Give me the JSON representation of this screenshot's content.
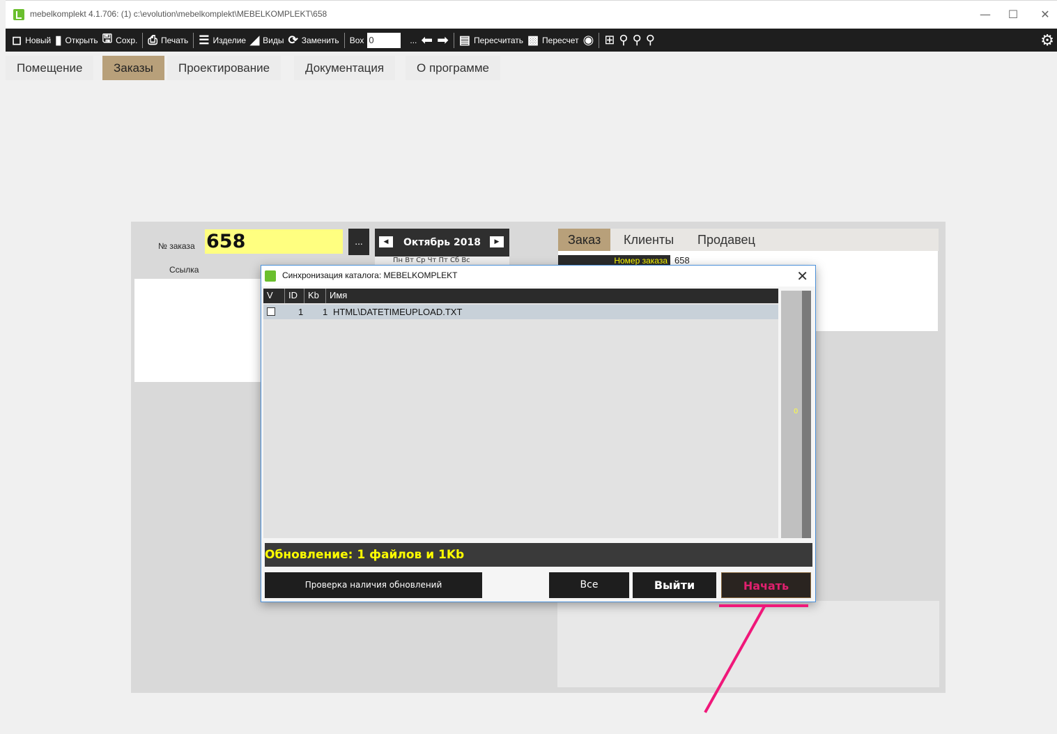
{
  "window": {
    "title": "mebelkomplekt 4.1.706: (1)  c:\\evolution\\mebelkomplekt\\MEBELKOMPLEKT\\658"
  },
  "toolbar": {
    "new": "Новый",
    "open": "Открыть",
    "save": "Сохр.",
    "print": "Печать",
    "product": "Изделие",
    "views": "Виды",
    "replace": "Заменить",
    "box_label": "Box",
    "box_value": "0",
    "ellipsis": "...",
    "recalculate": "Пересчитать",
    "recount": "Пересчет"
  },
  "main_tabs": [
    {
      "label": "Помещение",
      "active": false
    },
    {
      "label": "Заказы",
      "active": true
    },
    {
      "label": "Проектирование",
      "active": false
    },
    {
      "label": "Документация",
      "active": false
    },
    {
      "label": "О программе",
      "active": false
    }
  ],
  "order": {
    "number_label": "№ заказа",
    "number_value": "658",
    "link_label": "Ссылка",
    "dots": "...",
    "calendar_month": "Октябрь 2018",
    "calendar_days": "Пн  Вт  Ср  Чт  Пт  Сб  Вс"
  },
  "right_tabs": [
    {
      "label": "Заказ",
      "active": true
    },
    {
      "label": "Клиенты",
      "active": false
    },
    {
      "label": "Продавец",
      "active": false
    }
  ],
  "order_info": {
    "order_number_label": "Номер заказа",
    "order_number_value": "658"
  },
  "dialog": {
    "title": "Синхронизация каталога: MEBELKOMPLEKT",
    "columns": [
      "V",
      "ID",
      "Kb",
      "Имя"
    ],
    "rows": [
      {
        "checked": false,
        "id": "1",
        "kb": "1",
        "name": "HTML\\DATETIMEUPLOAD.TXT"
      }
    ],
    "scroll_value": "0",
    "status": "Обновление: 1 файлов и 1Kb",
    "btn_check": "Проверка наличия обновлений",
    "btn_all": "Все",
    "btn_exit": "Выйти",
    "btn_start": "Начать"
  },
  "colors": {
    "accent_tab": "#b8a07a",
    "toolbar_bg": "#1e1e1e",
    "order_highlight": "#ffff80",
    "status_text": "#ffff00",
    "start_text": "#e0206e",
    "annotation": "#f0187a"
  }
}
